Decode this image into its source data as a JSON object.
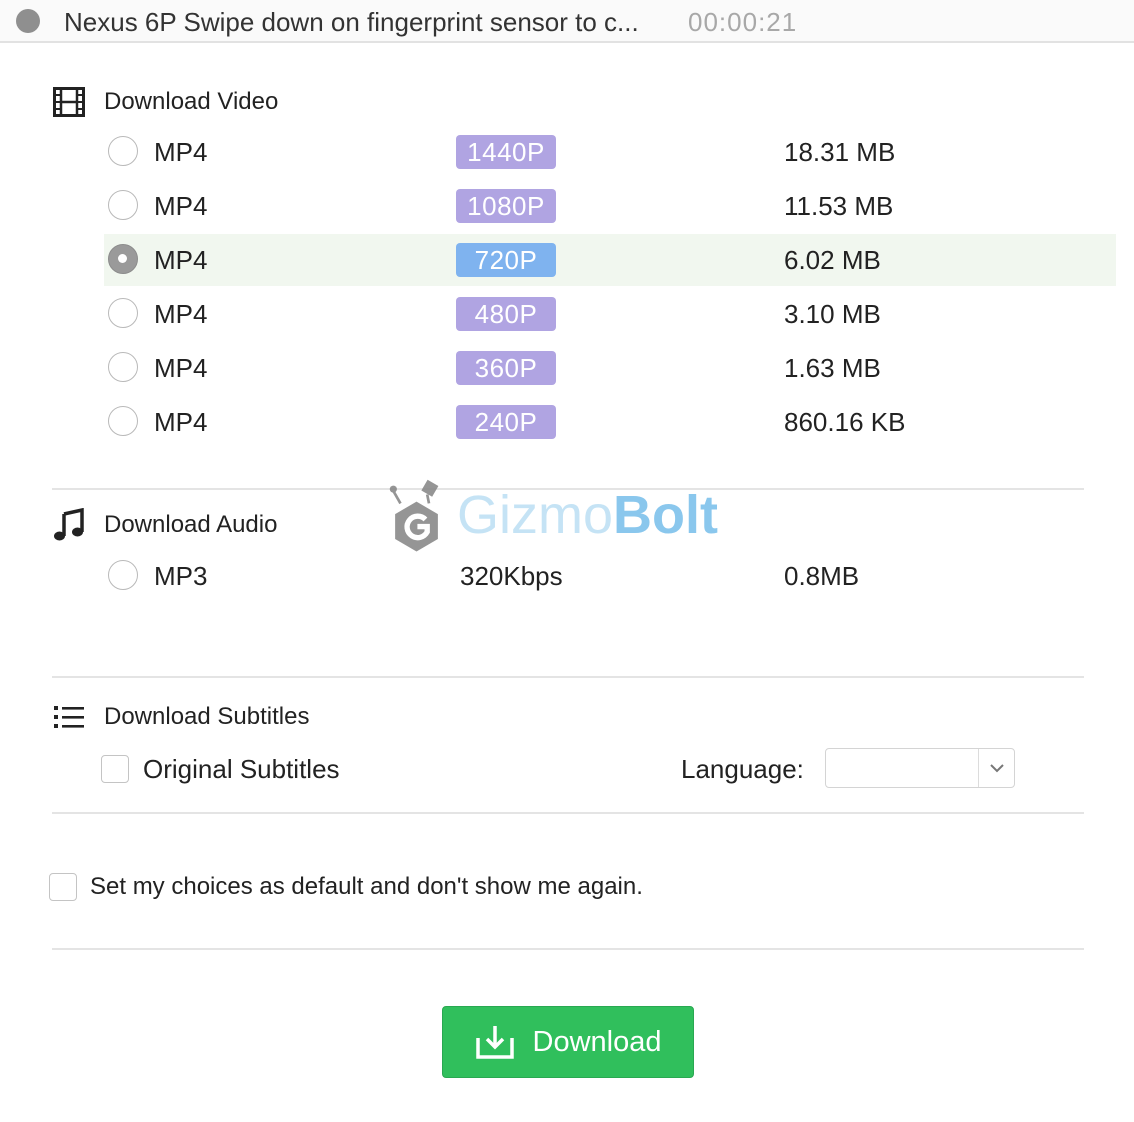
{
  "window": {
    "title": "Nexus 6P Swipe down on fingerprint sensor to c...",
    "duration": "00:00:21"
  },
  "video": {
    "heading": "Download Video",
    "options": [
      {
        "format": "MP4",
        "quality": "1440P",
        "size": "18.31 MB",
        "selected": false
      },
      {
        "format": "MP4",
        "quality": "1080P",
        "size": "11.53 MB",
        "selected": false
      },
      {
        "format": "MP4",
        "quality": "720P",
        "size": "6.02 MB",
        "selected": true
      },
      {
        "format": "MP4",
        "quality": "480P",
        "size": "3.10 MB",
        "selected": false
      },
      {
        "format": "MP4",
        "quality": "360P",
        "size": "1.63 MB",
        "selected": false
      },
      {
        "format": "MP4",
        "quality": "240P",
        "size": "860.16 KB",
        "selected": false
      }
    ]
  },
  "audio": {
    "heading": "Download Audio",
    "options": [
      {
        "format": "MP3",
        "bitrate": "320Kbps",
        "size": "0.8MB",
        "selected": false
      }
    ]
  },
  "subtitles": {
    "heading": "Download Subtitles",
    "original_label": "Original Subtitles",
    "original_checked": false,
    "language_label": "Language:",
    "language_value": ""
  },
  "defaults": {
    "label": "Set my choices as default and don't show me again.",
    "checked": false
  },
  "actions": {
    "download_label": "Download"
  },
  "watermark": {
    "text_a": "Gizmo",
    "text_b": "Bolt"
  },
  "colors": {
    "quality_badge": "#b0a4e2",
    "quality_badge_selected": "#7fb3ef",
    "download_button": "#30bf5c",
    "selected_row": "#f1f7ef"
  },
  "icons": {
    "video_heading": "film-icon",
    "audio_heading": "music-note-icon",
    "subtitles_heading": "list-icon",
    "download_button": "download-tray-icon",
    "language_select": "chevron-down-icon"
  }
}
